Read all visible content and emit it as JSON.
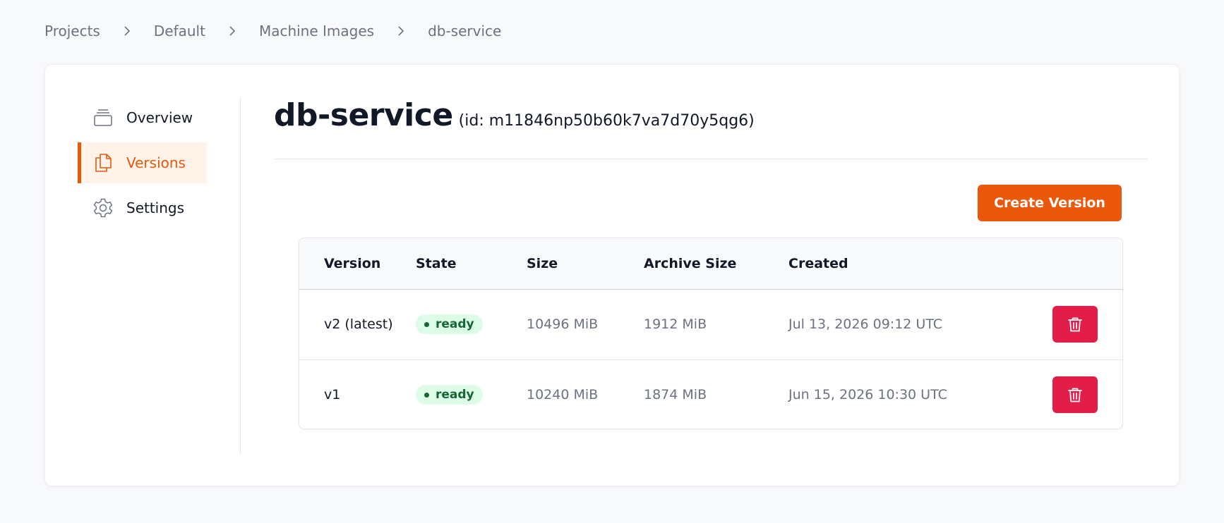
{
  "breadcrumb": {
    "items": [
      "Projects",
      "Default",
      "Machine Images",
      "db-service"
    ]
  },
  "sidebar": {
    "items": [
      {
        "label": "Overview",
        "icon": "archive-icon"
      },
      {
        "label": "Versions",
        "icon": "documents-icon",
        "active": true
      },
      {
        "label": "Settings",
        "icon": "gear-icon"
      }
    ]
  },
  "header": {
    "title": "db-service",
    "id_text": "(id: m11846np50b60k7va7d70y5qg6)"
  },
  "actions": {
    "create_label": "Create Version"
  },
  "table": {
    "columns": [
      "Version",
      "State",
      "Size",
      "Archive Size",
      "Created"
    ],
    "rows": [
      {
        "version": "v2 (latest)",
        "state": "ready",
        "size": "10496 MiB",
        "archive_size": "1912 MiB",
        "created": "Jul 13, 2026 09:12 UTC"
      },
      {
        "version": "v1",
        "state": "ready",
        "size": "10240 MiB",
        "archive_size": "1874 MiB",
        "created": "Jun 15, 2026 10:30 UTC"
      }
    ]
  },
  "colors": {
    "accent": "#ea580c",
    "danger": "#e11d48",
    "ready_bg": "#dcfce7",
    "ready_text": "#166534"
  }
}
